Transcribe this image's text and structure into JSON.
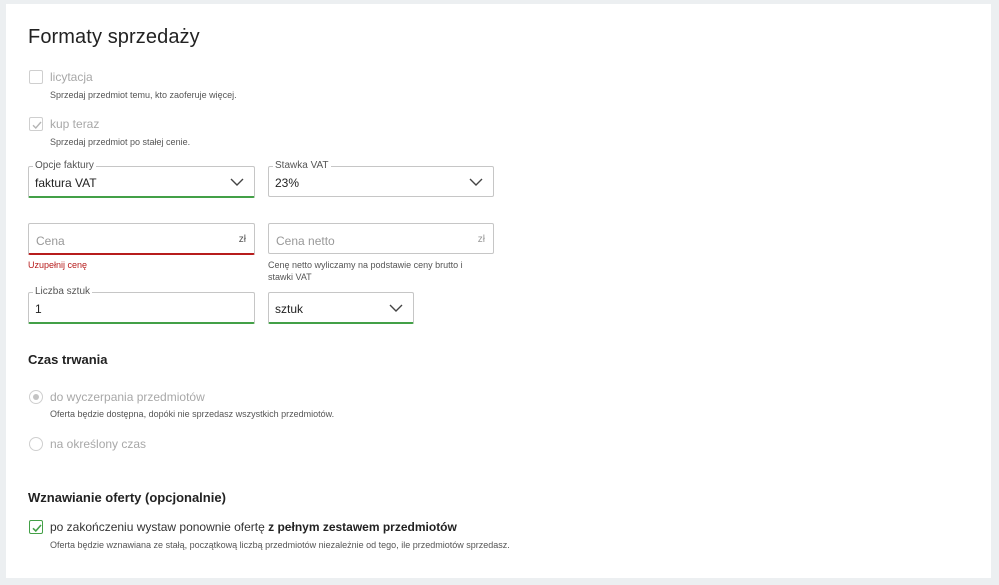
{
  "page": {
    "title": "Formaty sprzedaży"
  },
  "sale_formats": {
    "auction": {
      "label": "licytacja",
      "description": "Sprzedaj przedmiot temu, kto zaoferuje więcej.",
      "checked": false
    },
    "buy_now": {
      "label": "kup teraz",
      "description": "Sprzedaj przedmiot po stałej cenie.",
      "checked": true
    }
  },
  "invoice": {
    "legend": "Opcje faktury",
    "value": "faktura VAT"
  },
  "vat_rate": {
    "legend": "Stawka VAT",
    "value": "23%"
  },
  "price": {
    "placeholder": "Cena",
    "unit": "zł",
    "error": "Uzupełnij cenę"
  },
  "net_price": {
    "placeholder": "Cena netto",
    "unit": "zł",
    "hint_line1": "Cenę netto wyliczamy na podstawie ceny brutto i",
    "hint_line2": "stawki VAT"
  },
  "quantity": {
    "legend": "Liczba sztuk",
    "value": "1"
  },
  "unit_select": {
    "value": "sztuk"
  },
  "duration": {
    "title": "Czas trwania",
    "until_sold": {
      "label": "do wyczerpania przedmiotów",
      "description": "Oferta będzie dostępna, dopóki nie sprzedasz wszystkich przedmiotów.",
      "selected": true
    },
    "fixed_time": {
      "label": "na określony czas",
      "selected": false
    }
  },
  "renewal": {
    "title": "Wznawianie oferty (opcjonalnie)",
    "option": {
      "label_prefix": "po zakończeniu wystaw ponownie ofertę",
      "label_bold": "z pełnym zestawem przedmiotów",
      "description": "Oferta będzie wznawiana ze stałą, początkową liczbą przedmiotów niezależnie od tego, ile przedmiotów sprzedasz.",
      "checked": true
    }
  },
  "colors": {
    "accent_green": "#43a047",
    "error_red": "#b71c1c",
    "disabled_gray": "#a8a8a8"
  }
}
